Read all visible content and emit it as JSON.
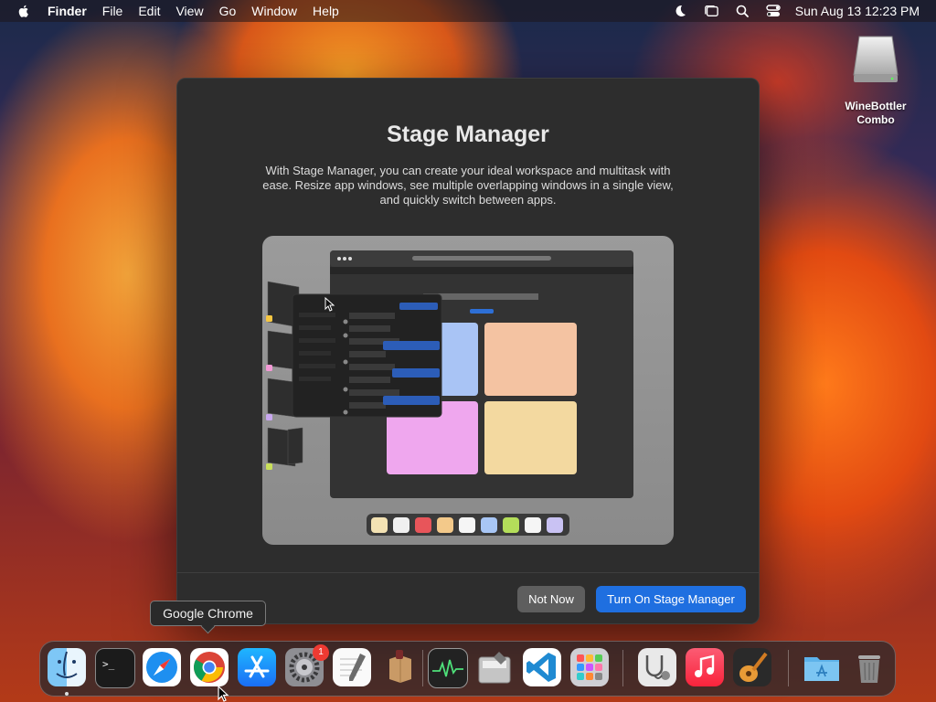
{
  "menubar": {
    "apple_icon": "apple-logo",
    "items": [
      "Finder",
      "File",
      "Edit",
      "View",
      "Go",
      "Window",
      "Help"
    ],
    "status_icons": [
      "do-not-disturb-moon-icon",
      "stage-manager-icon",
      "spotlight-search-icon",
      "control-center-icon"
    ],
    "clock": "Sun Aug 13  12:23 PM"
  },
  "desktop": {
    "drive_icon": "external-disk-icon",
    "drive_label_line1": "WineBottler",
    "drive_label_line2": "Combo"
  },
  "dialog": {
    "title": "Stage Manager",
    "description": "With Stage Manager, you can create your ideal workspace and multitask with ease. Resize app windows, see multiple overlapping windows in a single view, and quickly switch between apps.",
    "not_now_label": "Not Now",
    "turn_on_label": "Turn On Stage Manager",
    "illustration": {
      "thumbnail_colors": [
        "#f5c642",
        "#f39ad6",
        "#c9a8f0",
        "#c9e05a"
      ],
      "tile_colors": [
        "#a9c4f5",
        "#f4c3a2",
        "#efa7ee",
        "#f3d9a0"
      ],
      "swatch_colors": [
        "#f3e2b3",
        "#f0f0f0",
        "#e8555a",
        "#f3c98a",
        "#f5f5f5",
        "#a8c6f5",
        "#b4de5a",
        "#f5f5f5",
        "#c9c2f3"
      ]
    }
  },
  "tooltip": {
    "label": "Google Chrome"
  },
  "dock": {
    "apps": [
      {
        "name": "finder"
      },
      {
        "name": "terminal"
      },
      {
        "name": "safari"
      },
      {
        "name": "google-chrome"
      },
      {
        "name": "app-store"
      },
      {
        "name": "system-settings",
        "badge": "1"
      },
      {
        "name": "textedit"
      },
      {
        "name": "winebottler"
      },
      {
        "name": "activity-monitor"
      },
      {
        "name": "disk-utility"
      },
      {
        "name": "visual-studio-code"
      },
      {
        "name": "launchpad"
      },
      {
        "name": "system-information"
      },
      {
        "name": "music"
      },
      {
        "name": "garageband"
      },
      {
        "name": "applications-folder"
      },
      {
        "name": "trash"
      }
    ]
  }
}
